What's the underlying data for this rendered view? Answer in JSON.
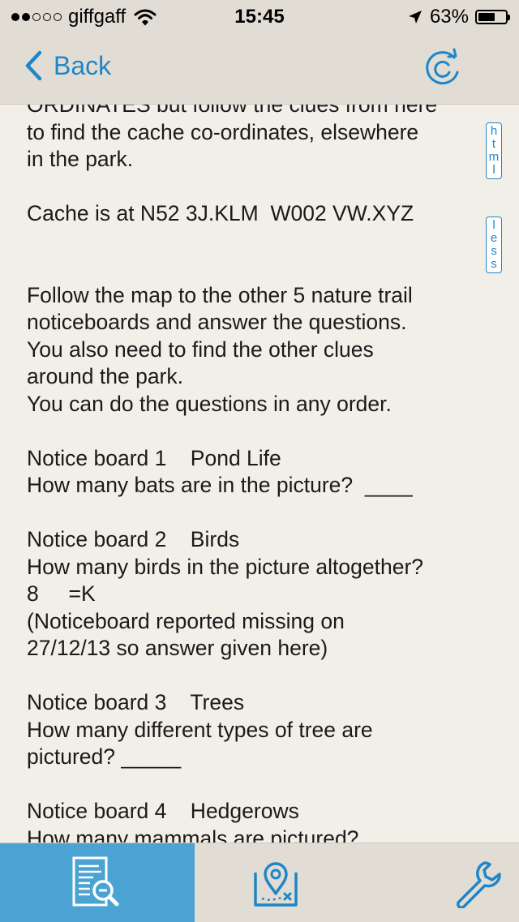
{
  "status_bar": {
    "carrier": "giffgaff",
    "time": "15:45",
    "battery": "63%",
    "battery_level": 0.63
  },
  "nav": {
    "back_label": "Back"
  },
  "side_tabs": {
    "html_letters": [
      "h",
      "t",
      "m",
      "l"
    ],
    "less_letters": [
      "l",
      "e",
      "s",
      "s"
    ]
  },
  "content_text": "ORDINATES but follow the clues from here\nto find the cache co-ordinates, elsewhere\nin the park.\n\nCache is at N52 3J.KLM  W002 VW.XYZ\n\n\nFollow the map to the other 5 nature trail\nnoticeboards and answer the questions.\nYou also need to find the other clues\naround the park.\nYou can do the questions in any order.\n\nNotice board 1    Pond Life\nHow many bats are in the picture?  ____\n\nNotice board 2    Birds\nHow many birds in the picture altogether?\n8     =K\n(Noticeboard reported missing on\n27/12/13 so answer given here)\n\nNotice board 3    Trees\nHow many different types of tree are\npictured? _____\n\nNotice board 4    Hedgerows\nHow many mammals are pictured?",
  "colors": {
    "accent": "#1f86c7",
    "active_tab": "#4aa3d2",
    "bar_background": "#e2ddd4",
    "page_background": "#f2efe8"
  },
  "tabs": [
    {
      "icon": "document-search-icon",
      "active": true
    },
    {
      "icon": "map-pin-icon",
      "active": false
    },
    {
      "icon": "wrench-icon",
      "active": false
    }
  ]
}
